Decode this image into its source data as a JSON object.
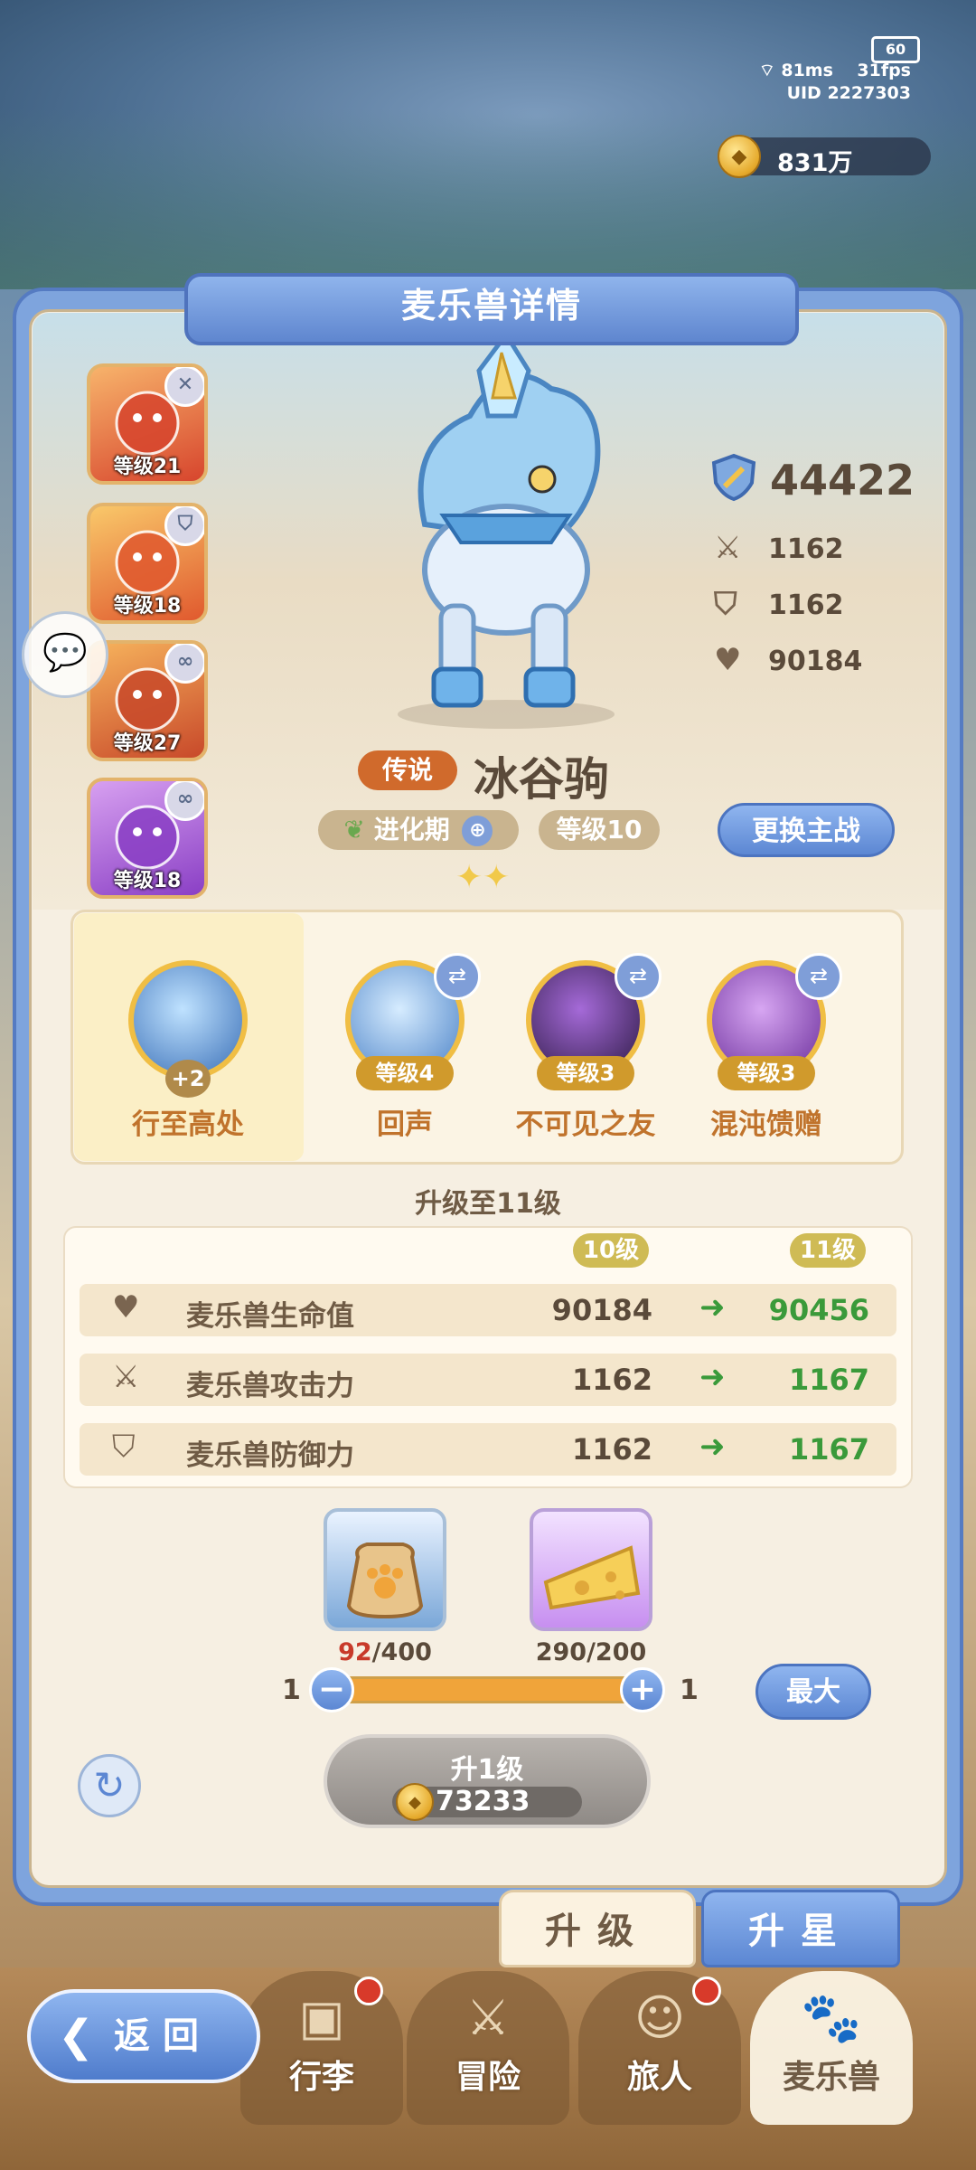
{
  "hud": {
    "battery": "60",
    "ping": "81ms",
    "fps": "31fps",
    "uid": "UID 2227303",
    "currency": "831万"
  },
  "panel": {
    "title": "麦乐兽详情"
  },
  "side_pets": [
    {
      "level_label": "等级21",
      "badge": "✕",
      "colors": [
        "#f7b36b",
        "#d7452d"
      ]
    },
    {
      "level_label": "等级18",
      "badge": "⛉",
      "colors": [
        "#f9c86a",
        "#e0592e"
      ]
    },
    {
      "level_label": "等级27",
      "badge": "∞",
      "colors": [
        "#f6b25c",
        "#c8492a"
      ]
    },
    {
      "level_label": "等级18",
      "badge": "∞",
      "colors": [
        "#d7a0f0",
        "#8a3fc5"
      ]
    }
  ],
  "pet": {
    "rarity": "传说",
    "name": "冰谷驹",
    "stage": "进化期",
    "level": "等级10",
    "swap_label": "更换主战",
    "power": "44422",
    "attack": "1162",
    "defense": "1162",
    "hp": "90184"
  },
  "skills": [
    {
      "name": "行至高处",
      "badge": "+2",
      "main": true,
      "colors": [
        "#bfe2ff",
        "#3a6fb7"
      ]
    },
    {
      "name": "回声",
      "level": "等级4",
      "colors": [
        "#d6ecff",
        "#4b82c7"
      ]
    },
    {
      "name": "不可见之友",
      "level": "等级3",
      "colors": [
        "#a56ad8",
        "#2d1a45"
      ]
    },
    {
      "name": "混沌馈赠",
      "level": "等级3",
      "colors": [
        "#d7a6f2",
        "#6a2d9a"
      ]
    }
  ],
  "upgrade": {
    "title": "升级至11级",
    "from_level": "10级",
    "to_level": "11级",
    "rows": [
      {
        "icon": "heart-icon",
        "label": "麦乐兽生命值",
        "old": "90184",
        "new": "90456"
      },
      {
        "icon": "swords-icon",
        "label": "麦乐兽攻击力",
        "old": "1162",
        "new": "1167"
      },
      {
        "icon": "shield-icon",
        "label": "麦乐兽防御力",
        "old": "1162",
        "new": "1167"
      }
    ],
    "items": [
      {
        "name": "feed-bag",
        "have": "92",
        "need": "/400",
        "colors": [
          "#eaf3ff",
          "#7aa7d8"
        ]
      },
      {
        "name": "cheese",
        "have_text": "290/200",
        "colors": [
          "#f2e2ff",
          "#c78ff0"
        ]
      }
    ],
    "slider_min": "1",
    "slider_max": "1",
    "slider_fill": 1.0,
    "max_label": "最大",
    "button_label": "升1级",
    "cost": "73233"
  },
  "tabs": {
    "upgrade": "升级",
    "star": "升星"
  },
  "nav": {
    "back": "返回",
    "items": [
      "行李",
      "冒险",
      "旅人",
      "麦乐兽"
    ]
  }
}
